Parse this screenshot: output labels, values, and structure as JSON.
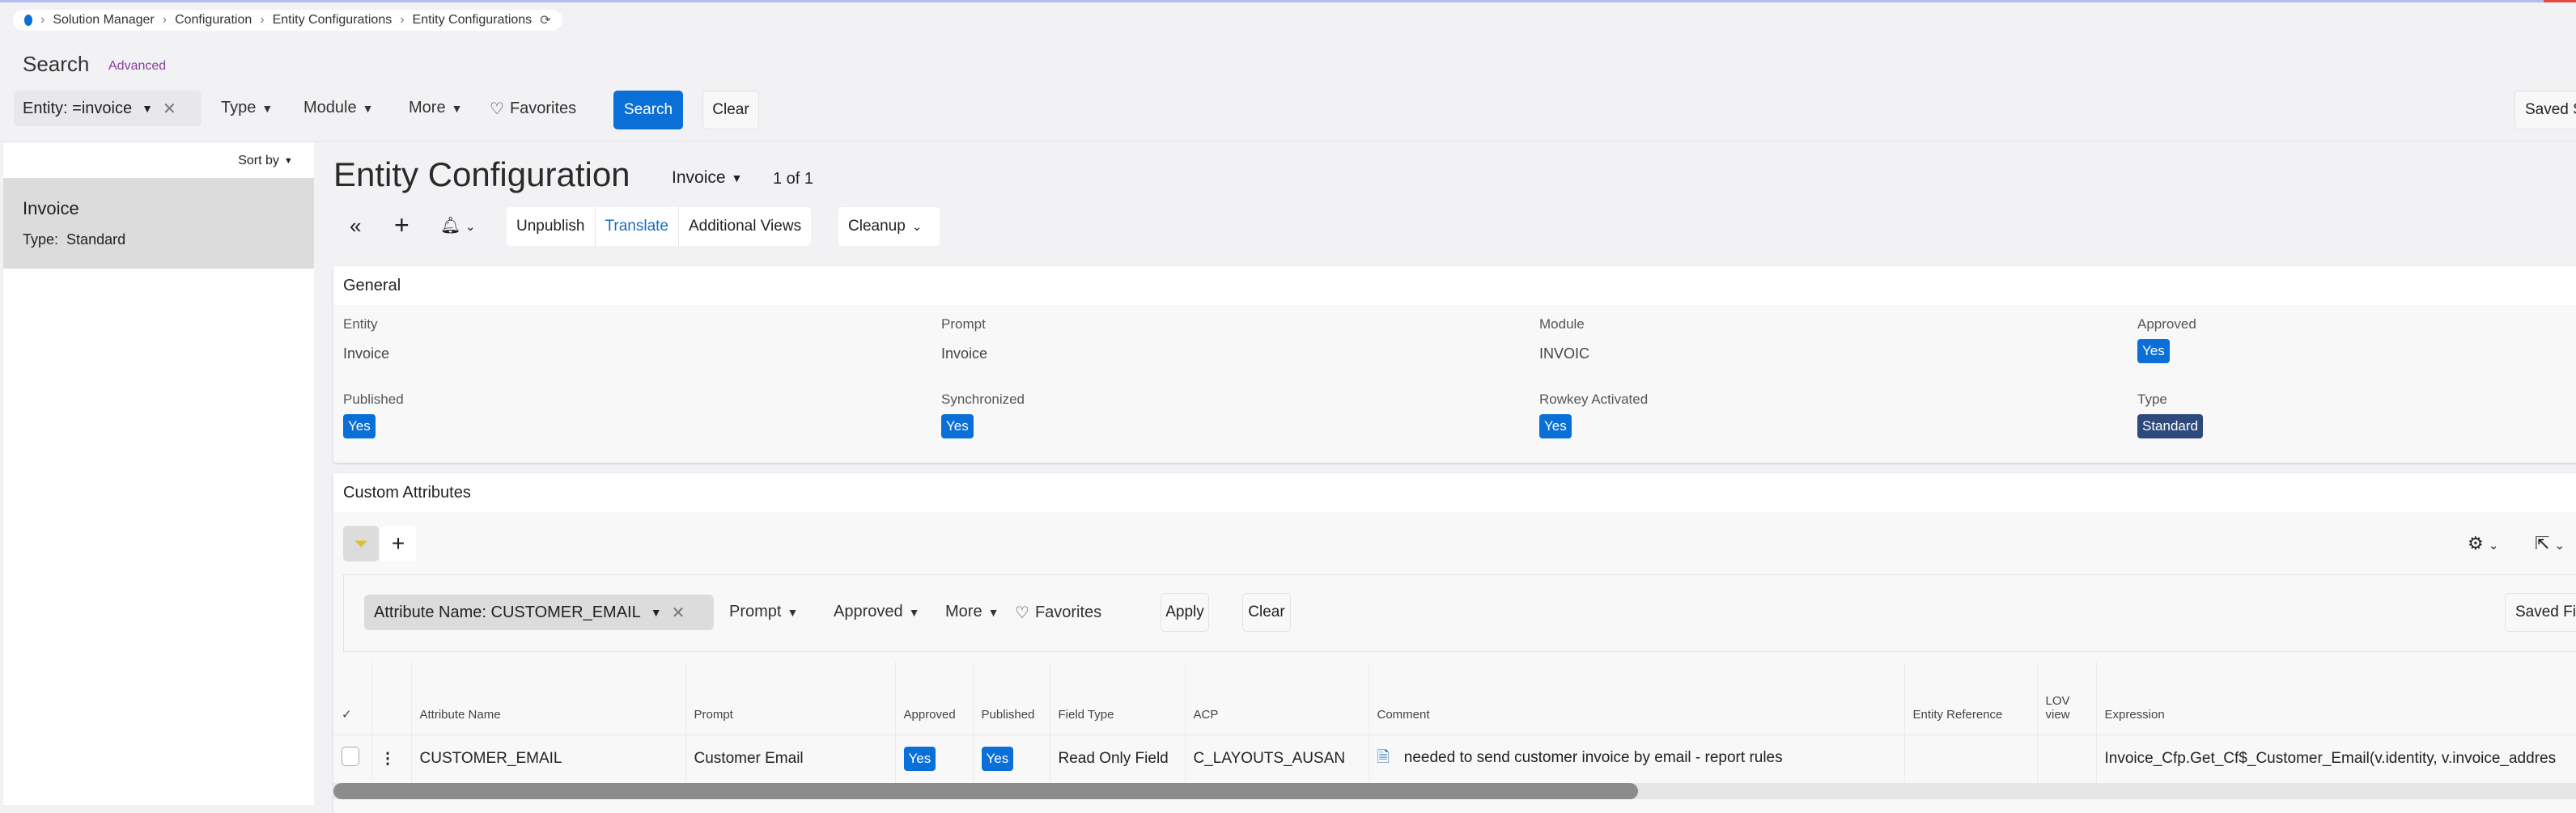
{
  "breadcrumb": [
    "Solution Manager",
    "Configuration",
    "Entity Configurations",
    "Entity Configurations"
  ],
  "search": {
    "title": "Search",
    "advanced": "Advanced",
    "chip": "Entity: =invoice",
    "filters": [
      "Type",
      "Module",
      "More"
    ],
    "favorites": "Favorites",
    "search_btn": "Search",
    "clear_btn": "Clear",
    "saved": "Saved S"
  },
  "list": {
    "sort": "Sort by",
    "items": [
      {
        "name": "Invoice",
        "type_label": "Type:",
        "type": "Standard"
      }
    ]
  },
  "main": {
    "title": "Entity Configuration",
    "selector": "Invoice",
    "pager": "1 of 1",
    "toolbar": {
      "unpublish": "Unpublish",
      "translate": "Translate",
      "views": "Additional Views",
      "cleanup": "Cleanup"
    }
  },
  "general": {
    "title": "General",
    "fields": [
      {
        "label": "Entity",
        "value": "Invoice"
      },
      {
        "label": "Prompt",
        "value": "Invoice"
      },
      {
        "label": "Module",
        "value": "INVOIC"
      },
      {
        "label": "Approved",
        "badge": "Yes"
      },
      {
        "label": "Published",
        "badge": "Yes"
      },
      {
        "label": "Synchronized",
        "badge": "Yes"
      },
      {
        "label": "Rowkey Activated",
        "badge": "Yes"
      },
      {
        "label": "Type",
        "badge": "Standard"
      }
    ]
  },
  "custom": {
    "title": "Custom Attributes",
    "chip": "Attribute Name: CUSTOMER_EMAIL",
    "filters": [
      "Prompt",
      "Approved",
      "More"
    ],
    "favorites": "Favorites",
    "apply": "Apply",
    "clear": "Clear",
    "saved": "Saved Fil",
    "columns": [
      "✓",
      "",
      "Attribute Name",
      "Prompt",
      "Approved",
      "Published",
      "Field Type",
      "ACP",
      "Comment",
      "Entity Reference",
      "LOV view",
      "Expression"
    ],
    "rows": [
      {
        "name": "CUSTOMER_EMAIL",
        "prompt": "Customer Email",
        "approved": "Yes",
        "published": "Yes",
        "field_type": "Read Only Field",
        "acp": "C_LAYOUTS_AUSAN",
        "comment": "needed to send customer invoice by email - report rules",
        "entity_ref": "",
        "lov": "",
        "expression": "Invoice_Cfp.Get_Cf$_Customer_Email(v.identity, v.invoice_addres"
      }
    ]
  },
  "colors": {
    "accent": "#0a6fd6",
    "standard": "#2d4a7a"
  }
}
